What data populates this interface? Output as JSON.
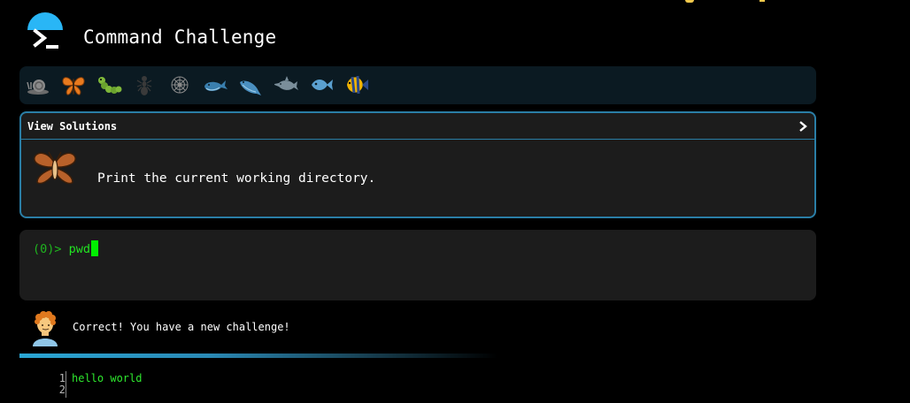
{
  "header": {
    "title": "Command Challenge",
    "logo_icon": "terminal-prompt-icon",
    "accent_color": "#29b6f6"
  },
  "levels": [
    {
      "icon": "snail-icon",
      "state": "completed"
    },
    {
      "icon": "butterfly-icon",
      "state": "current"
    },
    {
      "icon": "caterpillar-icon",
      "state": "locked"
    },
    {
      "icon": "ant-icon",
      "state": "locked"
    },
    {
      "icon": "spider-web-icon",
      "state": "locked"
    },
    {
      "icon": "whale-icon",
      "state": "locked"
    },
    {
      "icon": "spouting-whale-icon",
      "state": "locked"
    },
    {
      "icon": "dolphin-icon",
      "state": "locked"
    },
    {
      "icon": "fish-icon",
      "state": "locked"
    },
    {
      "icon": "tropical-fish-icon",
      "state": "locked"
    }
  ],
  "challenge": {
    "view_solutions_label": "View Solutions",
    "expand_icon": "chevron-right-icon",
    "icon": "moth-icon",
    "text": "Print the current working directory.",
    "border_color": "#2a7ea6"
  },
  "terminal": {
    "prompt": "(0)>",
    "command": "pwd",
    "text_color": "#22e322"
  },
  "feedback": {
    "avatar_icon": "person-curly-hair-icon",
    "message": "Correct! You have a new challenge!"
  },
  "output": {
    "line_numbers": [
      "1",
      "2"
    ],
    "lines": [
      "hello world",
      ""
    ]
  }
}
